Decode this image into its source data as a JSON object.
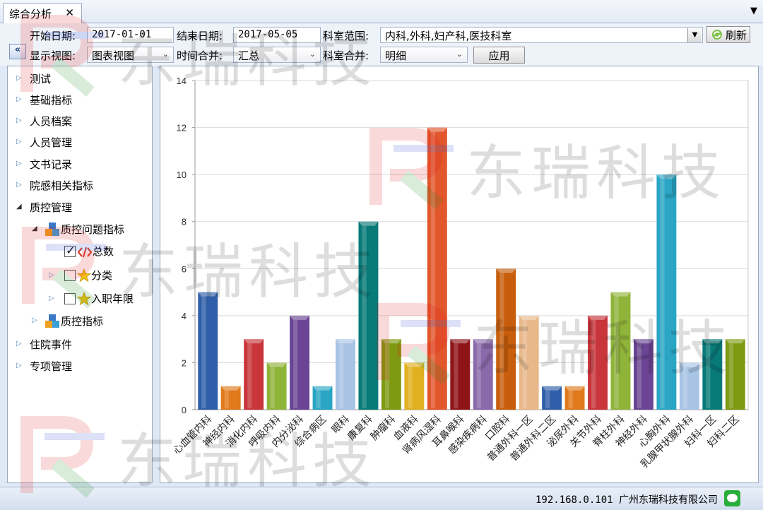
{
  "tab": {
    "title": "综合分析",
    "close": "✕",
    "menu": "▼"
  },
  "toolbar": {
    "start_label": "开始日期:",
    "start_value": "2017-01-01",
    "end_label": "结束日期:",
    "end_value": "2017-05-05",
    "dept_range_label": "科室范围:",
    "dept_range_value": "内科,外科,妇产科,医技科室",
    "refresh_label": "刷新",
    "view_label": "显示视图:",
    "view_value": "图表视图",
    "time_merge_label": "时间合并:",
    "time_merge_value": "汇总",
    "dept_merge_label": "科室合并:",
    "dept_merge_value": "明细",
    "apply_label": "应用",
    "collapse": "«"
  },
  "tree": {
    "items": [
      {
        "label": "测试"
      },
      {
        "label": "基础指标"
      },
      {
        "label": "人员档案"
      },
      {
        "label": "人员管理"
      },
      {
        "label": "文书记录"
      },
      {
        "label": "院感相关指标"
      },
      {
        "label": "质控管理"
      },
      {
        "label": "质控问题指标"
      },
      {
        "label": "总数"
      },
      {
        "label": "分类"
      },
      {
        "label": "入职年限"
      },
      {
        "label": "质控指标"
      },
      {
        "label": "住院事件"
      },
      {
        "label": "专项管理"
      }
    ]
  },
  "status": {
    "text": "192.168.0.101 广州东瑞科技有限公司"
  },
  "watermark": {
    "text": "东瑞科技"
  },
  "chart_data": {
    "type": "bar",
    "categories": [
      "心血管内科",
      "神经内科",
      "消化内科",
      "呼吸内科",
      "内分泌科",
      "综合病区",
      "眼科",
      "康复科",
      "肿瘤科",
      "血液科",
      "肾病风湿科",
      "耳鼻喉科",
      "感染疾病科",
      "口腔科",
      "普通外科一区",
      "普通外科二区",
      "泌尿外科",
      "关节外科",
      "脊柱外科",
      "神经外科",
      "心胸外科",
      "乳腺甲状腺外科",
      "妇科一区",
      "妇科二区"
    ],
    "values": [
      5,
      1,
      3,
      2,
      4,
      1,
      3,
      8,
      3,
      2,
      12,
      3,
      3,
      6,
      4,
      1,
      1,
      4,
      5,
      3,
      10,
      2,
      3,
      3
    ],
    "colors": [
      "#2f5fa8",
      "#e07a1c",
      "#c8353a",
      "#8fb43a",
      "#6b4594",
      "#2aa6c4",
      "#a8c4e4",
      "#087a78",
      "#7e9a12",
      "#e0b020",
      "#e2562c",
      "#8e1418",
      "#8a6aaa",
      "#c85e0c",
      "#e8b88a",
      "#2f5fa8",
      "#e07a1c",
      "#c8353a",
      "#8fb43a",
      "#6b4594",
      "#2aa6c4",
      "#a8c4e4",
      "#087a78",
      "#7e9a12"
    ],
    "ylim": [
      0,
      14
    ],
    "yticks": [
      "0",
      "2",
      "4",
      "6",
      "8",
      "10",
      "12",
      "14"
    ],
    "grid": true
  }
}
